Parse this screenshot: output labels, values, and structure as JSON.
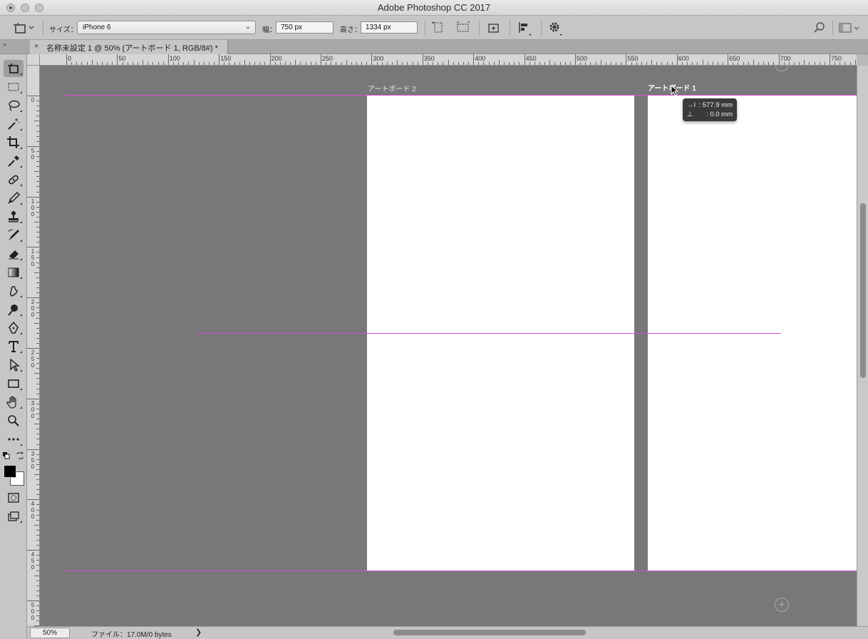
{
  "window": {
    "title": "Adobe Photoshop CC 2017"
  },
  "options_bar": {
    "size_label": "サイズ：",
    "size_value": "iPhone 6",
    "width_label": "幅：",
    "width_value": "750 px",
    "height_label": "高さ：",
    "height_value": "1334 px"
  },
  "document_tab": {
    "close": "×",
    "name": "名称未設定 1 @ 50% (アートボード 1, RGB/8#) *"
  },
  "ruler_top_labels": [
    "0",
    "50",
    "100",
    "150",
    "200",
    "250",
    "300",
    "350",
    "400",
    "450",
    "500",
    "550",
    "600",
    "650",
    "700",
    "750"
  ],
  "ruler_left_labels": [
    "0",
    "50",
    "100",
    "150",
    "200",
    "250",
    "300",
    "350",
    "400",
    "450",
    "500"
  ],
  "canvas": {
    "artboard_2_label": "アートボード 2",
    "artboard_1_label": "アートボード 1",
    "add_artboard": "+",
    "tooltip_x_icon": "→I",
    "tooltip_x_value": ": 577.9 mm",
    "tooltip_y_icon": "⊥",
    "tooltip_y_value": ":      0.0 mm"
  },
  "status": {
    "zoom": "50%",
    "file_info": "ファイル：17.0M/0 bytes",
    "arrow": "❯"
  },
  "colors": {
    "guide": "#d64ed0",
    "pasteboard": "#787878",
    "artboard": "#ffffff",
    "foreground": "#000000",
    "background": "#ffffff"
  }
}
